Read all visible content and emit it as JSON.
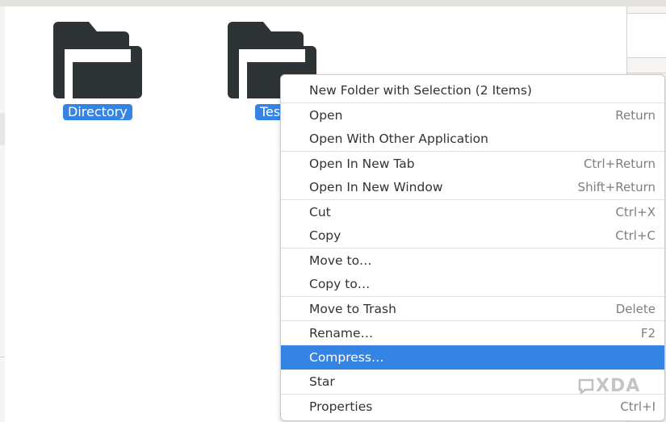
{
  "colors": {
    "accent": "#3584e4",
    "folder": "#2e3436",
    "menu_text": "#2e3436",
    "shortcut_text": "#7c7f80",
    "watermark": "#9e9e9e"
  },
  "files": [
    {
      "label": "Directory",
      "icon": "folder-icon",
      "selected": true
    },
    {
      "label": "Tes",
      "icon": "folder-icon",
      "selected": true
    }
  ],
  "context_menu": {
    "items": [
      {
        "label": "New Folder with Selection (2 Items)",
        "shortcut": ""
      },
      {
        "label": "Open",
        "shortcut": "Return"
      },
      {
        "label": "Open With Other Application",
        "shortcut": ""
      },
      {
        "label": "Open In New Tab",
        "shortcut": "Ctrl+Return"
      },
      {
        "label": "Open In New Window",
        "shortcut": "Shift+Return"
      },
      {
        "label": "Cut",
        "shortcut": "Ctrl+X"
      },
      {
        "label": "Copy",
        "shortcut": "Ctrl+C"
      },
      {
        "label": "Move to…",
        "shortcut": ""
      },
      {
        "label": "Copy to…",
        "shortcut": ""
      },
      {
        "label": "Move to Trash",
        "shortcut": "Delete"
      },
      {
        "label": "Rename…",
        "shortcut": "F2"
      },
      {
        "label": "Compress…",
        "shortcut": "",
        "highlighted": true
      },
      {
        "label": "Star",
        "shortcut": ""
      },
      {
        "label": "Properties",
        "shortcut": "Ctrl+I"
      }
    ]
  },
  "watermark": {
    "text": "XDA",
    "icon": "xda-logo-icon"
  }
}
